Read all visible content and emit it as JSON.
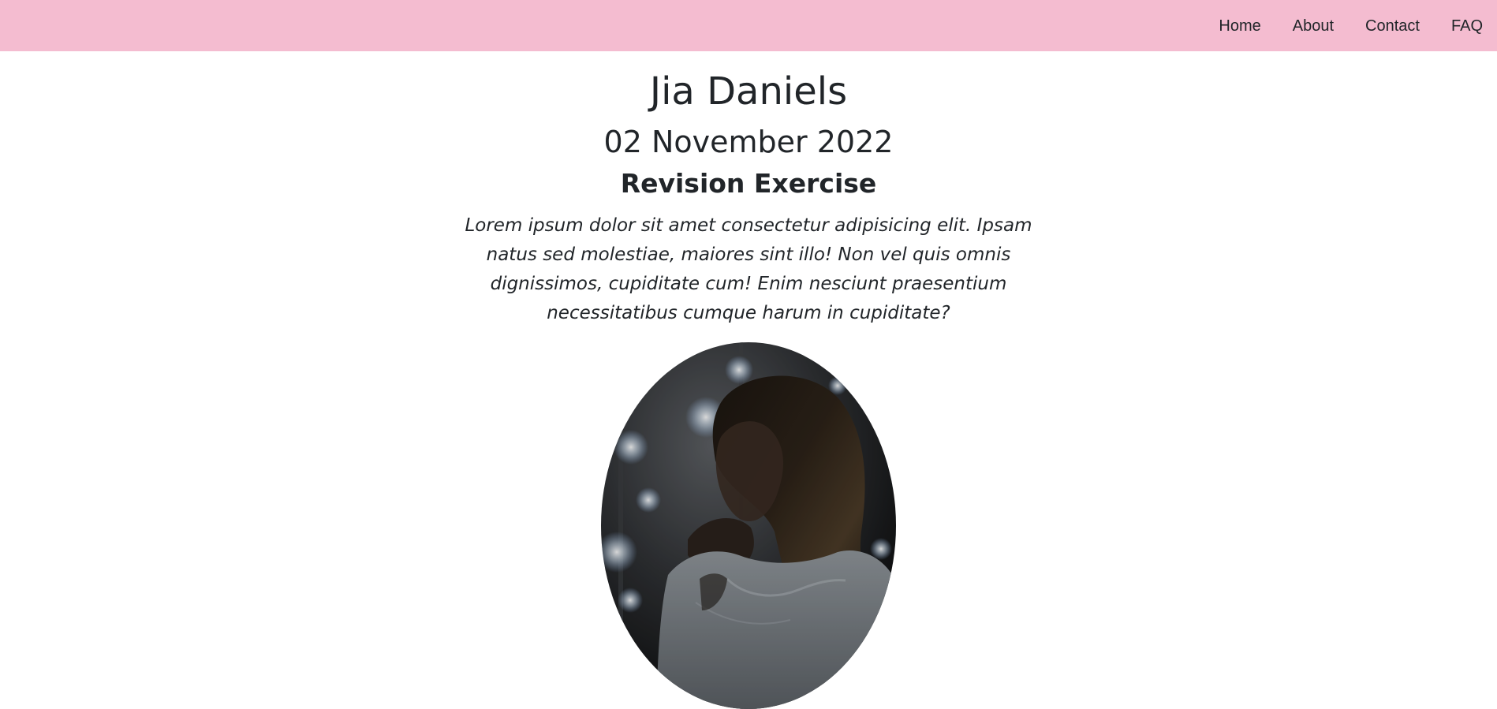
{
  "nav": {
    "items": [
      {
        "label": "Home"
      },
      {
        "label": "About"
      },
      {
        "label": "Contact"
      },
      {
        "label": "FAQ"
      }
    ]
  },
  "profile": {
    "name": "Jia Daniels",
    "date": "02 November 2022",
    "title": "Revision Exercise",
    "text": "Lorem ipsum dolor sit amet consectetur adipisicing elit. Ipsam natus sed molestiae, maiores sint illo! Non vel quis omnis dignissimos, cupiditate cum! Enim nesciunt praesentium necessitatibus cumque harum in cupiditate?"
  },
  "colors": {
    "navbar_bg": "#f4bcd0",
    "text": "#212529"
  },
  "icons": {
    "portrait": "portrait-image"
  }
}
